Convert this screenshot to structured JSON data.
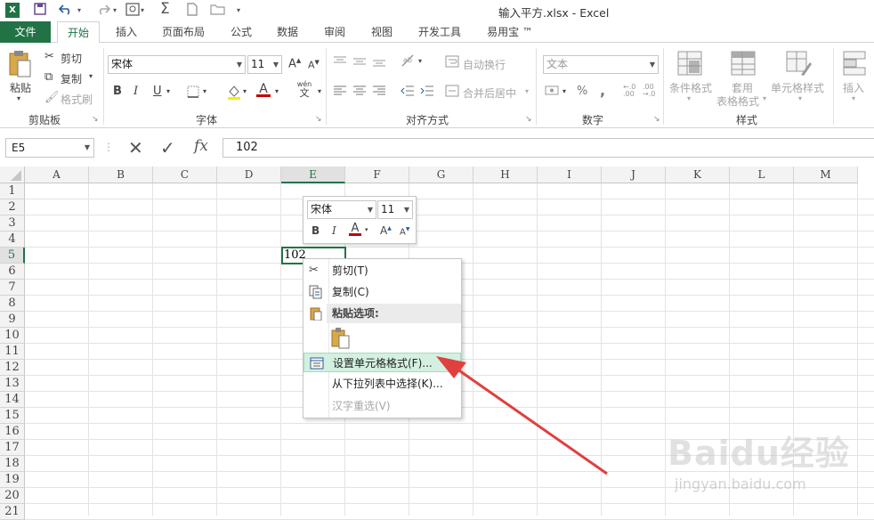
{
  "title": "输入平方.xlsx - Excel",
  "tabs": [
    "文件",
    "开始",
    "插入",
    "页面布局",
    "公式",
    "数据",
    "审阅",
    "视图",
    "开发工具",
    "易用宝 ™"
  ],
  "ribbon": {
    "clipboard": {
      "paste": "粘贴",
      "cut": "剪切",
      "copy": "复制",
      "format_painter": "格式刷",
      "label": "剪贴板"
    },
    "font": {
      "name": "宋体",
      "size": "11",
      "bold": "B",
      "italic": "I",
      "underline": "U",
      "wen": "wén",
      "wen_sub": "文",
      "label": "字体"
    },
    "alignment": {
      "wrap": "自动换行",
      "merge": "合并后居中",
      "label": "对齐方式"
    },
    "number": {
      "format": "文本",
      "percent": "%",
      "comma": ",",
      "label": "数字"
    },
    "styles": {
      "conditional": "条件格式",
      "table_1": "套用",
      "table_2": "表格格式",
      "cell_styles": "单元格样式",
      "label": "样式"
    },
    "cells": {
      "insert": "插入"
    }
  },
  "formula_bar": {
    "name_box": "E5",
    "content": "102",
    "fx": "fx"
  },
  "columns": [
    "A",
    "B",
    "C",
    "D",
    "E",
    "F",
    "G",
    "H",
    "I",
    "J",
    "K",
    "L",
    "M"
  ],
  "rows": [
    "1",
    "2",
    "3",
    "4",
    "5",
    "6",
    "7",
    "8",
    "9",
    "10",
    "11",
    "12",
    "13",
    "14",
    "15",
    "16",
    "17",
    "18",
    "19",
    "20",
    "21"
  ],
  "active_cell_value": "102",
  "mini_toolbar": {
    "font": "宋体",
    "size": "11",
    "bold": "B",
    "italic": "I",
    "color": "A",
    "grow": "A",
    "shrink": "A"
  },
  "context_menu": {
    "cut": "剪切(T)",
    "copy": "复制(C)",
    "paste_options": "粘贴选项:",
    "format_cells": "设置单元格格式(F)...",
    "pick_list": "从下拉列表中选择(K)...",
    "reconvert": "汉字重选(V)"
  },
  "watermark": {
    "brand": "Baidu经验",
    "url": "jingyan.baidu.com"
  },
  "colors": {
    "excel_green": "#217346",
    "font_red": "#c00000",
    "arrow_red": "#e04040"
  }
}
